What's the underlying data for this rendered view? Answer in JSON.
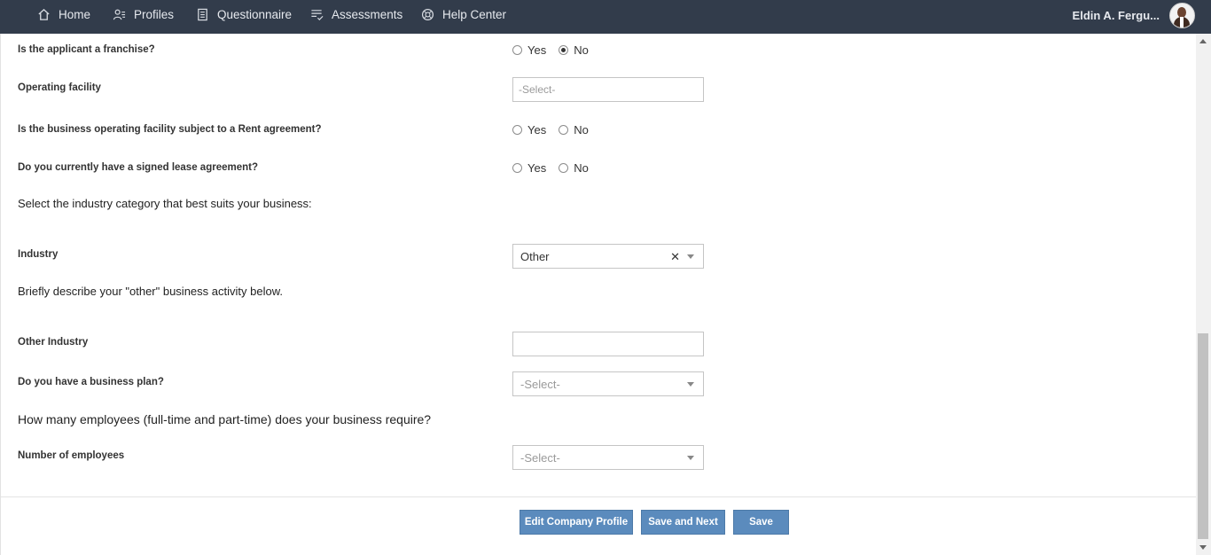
{
  "nav": {
    "items": [
      {
        "label": "Home",
        "icon": "home-icon"
      },
      {
        "label": "Profiles",
        "icon": "profiles-icon"
      },
      {
        "label": "Questionnaire",
        "icon": "questionnaire-icon"
      },
      {
        "label": "Assessments",
        "icon": "assessments-icon"
      },
      {
        "label": "Help Center",
        "icon": "help-center-icon"
      }
    ],
    "user_name": "Eldin A. Fergu..."
  },
  "form": {
    "franchise": {
      "label": "Is the applicant a franchise?",
      "yes": "Yes",
      "no": "No",
      "selected": "No"
    },
    "operating_facility": {
      "label": "Operating facility",
      "placeholder": "-Select-"
    },
    "rent_agreement": {
      "label": "Is the business operating facility subject to a Rent agreement?",
      "yes": "Yes",
      "no": "No",
      "selected": ""
    },
    "lease_agreement": {
      "label": "Do you currently have a signed lease agreement?",
      "yes": "Yes",
      "no": "No",
      "selected": ""
    },
    "industry_heading": "Select the industry category that best suits your business:",
    "industry": {
      "label": "Industry",
      "value": "Other"
    },
    "other_heading": "Briefly describe your \"other\" business activity below.",
    "other_industry": {
      "label": "Other Industry",
      "value": ""
    },
    "business_plan": {
      "label": "Do you have a business plan?",
      "value": "-Select-"
    },
    "employees_heading": "How many employees (full-time and part-time) does your business require?",
    "num_employees": {
      "label": "Number of employees",
      "value": "-Select-"
    }
  },
  "buttons": {
    "edit_profile": "Edit Company Profile",
    "save_next": "Save and Next",
    "save": "Save"
  },
  "colors": {
    "topbar": "#323c4b",
    "button": "#5b8bbd"
  }
}
